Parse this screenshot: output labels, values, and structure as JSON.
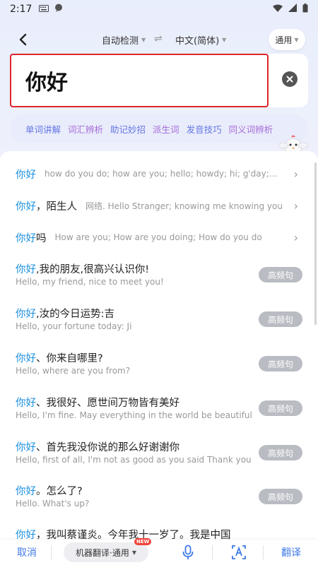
{
  "status_bar": {
    "time": "2:17",
    "icons_left": [
      "keyboard-icon",
      "chat-bubble-icon"
    ],
    "icons_right": [
      "wifi-icon",
      "signal-icon",
      "battery-icon"
    ]
  },
  "top_bar": {
    "source_lang": "自动检测",
    "target_lang": "中文(简体)",
    "mode": "通用"
  },
  "input": {
    "value": "你好"
  },
  "chips": [
    "单词讲解",
    "词汇辨析",
    "助记妙招",
    "派生词",
    "发音技巧",
    "同义词辨析"
  ],
  "suggestions_single": [
    {
      "hw_blue": "你好",
      "hw_rest": "",
      "definition": "how do you do; how are you; hello; howdy; hi; g'day; good..."
    },
    {
      "hw_blue": "你好",
      "hw_rest": "，陌生人",
      "definition": "网络. Hello Stranger; knowing me knowing you"
    },
    {
      "hw_blue": "你好",
      "hw_rest": "吗",
      "definition": "How are you; How are you doing; How do you do"
    }
  ],
  "suggestions_sentences": [
    {
      "hw_blue": "你好",
      "hw_rest": ",我的朋友,很高兴认识你!",
      "translation": "Hello, my friend, nice to meet you!",
      "badge": "高频句"
    },
    {
      "hw_blue": "你好",
      "hw_rest": ",汝的今日运势:吉",
      "translation": "Hello, your fortune today: Ji",
      "badge": "高频句"
    },
    {
      "hw_blue": "你好",
      "hw_rest": "、你来自哪里?",
      "translation": "Hello, where are you from?",
      "badge": "高频句"
    },
    {
      "hw_blue": "你好",
      "hw_rest": "、我很好、愿世间万物皆有美好",
      "translation": "Hello, I'm fine. May everything in the world be beautiful",
      "badge": "高频句"
    },
    {
      "hw_blue": "你好",
      "hw_rest": "、首先我没你说的那么好谢谢你",
      "translation": "Hello, first of all, I'm not as good as you said Thank you",
      "badge": "高频句"
    },
    {
      "hw_blue": "你好",
      "hw_rest": "。怎么了?",
      "translation": "Hello. What's up?",
      "badge": "高频句"
    },
    {
      "hw_blue": "你好",
      "hw_rest": "，我叫蔡谨炎。今年我十一岁了。我是中国",
      "translation": "",
      "badge": ""
    }
  ],
  "bottom_bar": {
    "cancel": "取消",
    "engine": "机器翻译·通用",
    "new_badge": "NEW",
    "translate": "翻译"
  },
  "colors": {
    "accent_blue": "#1a8fe0",
    "action_blue": "#3f79e8",
    "highlight_red": "#e0262a",
    "chip_blue": "#6677e6",
    "chip_purple": "#a56bd8"
  }
}
